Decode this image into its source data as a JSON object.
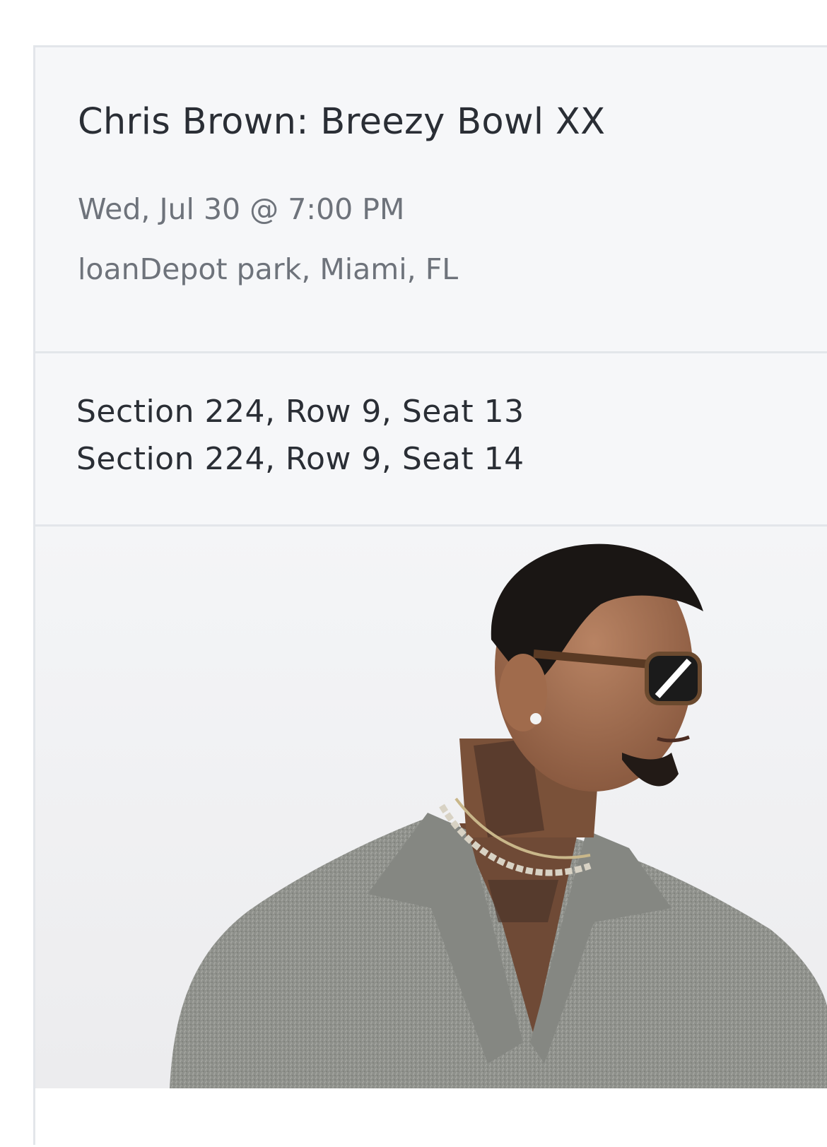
{
  "event": {
    "title": "Chris Brown: Breezy Bowl XX",
    "date": "Wed, Jul 30 @ 7:00 PM",
    "venue": "loanDepot park, Miami, FL"
  },
  "seats": [
    "Section 224, Row 9, Seat 13",
    "Section 224, Row 9, Seat 14"
  ],
  "colors": {
    "card_background": "#f6f7f9",
    "divider": "#e3e6ea",
    "title_text": "#2a2e35",
    "secondary_text": "#6e737b"
  }
}
